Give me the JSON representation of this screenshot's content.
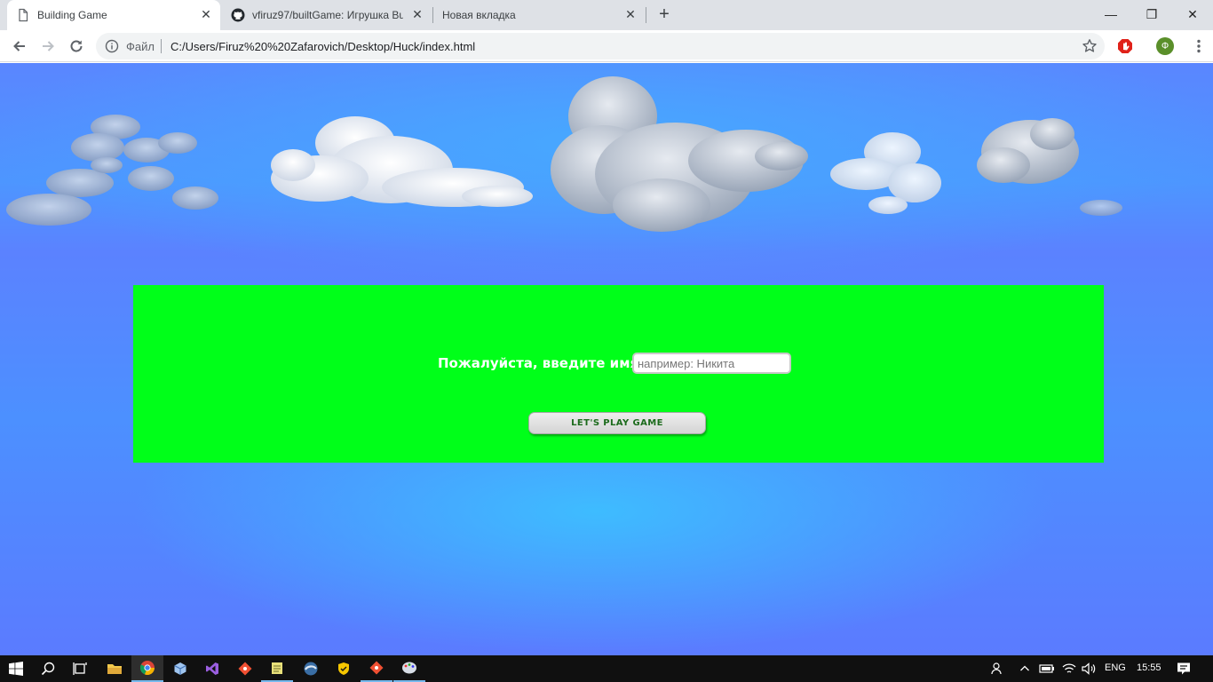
{
  "browser": {
    "tabs": [
      {
        "title": "Building Game",
        "icon": "page-icon",
        "active": true
      },
      {
        "title": "vfiruz97/builtGame: Игрушка Bui",
        "icon": "github-icon",
        "active": false
      },
      {
        "title": "Новая вкладка",
        "icon": "none",
        "active": false
      }
    ],
    "close_glyph": "✕",
    "new_tab_glyph": "+",
    "window_controls": {
      "minimize": "—",
      "restore": "❐",
      "close": "✕"
    },
    "address": {
      "scheme_label": "Файл",
      "url": "C:/Users/Firuz%20%20Zafarovich/Desktop/Huck/index.html"
    },
    "profile_initial": "Ф"
  },
  "page": {
    "prompt_label": "Пожалуйста, введите имя:",
    "name_input": {
      "value": "",
      "placeholder": "например: Никита"
    },
    "play_button": "LET'S PLAY GAME",
    "colors": {
      "panel": "#00ff19",
      "sky": "#4d96ff",
      "button_text": "#1c6b1c"
    }
  },
  "taskbar": {
    "apps": [
      "file-explorer-icon",
      "chrome-icon",
      "virtualbox-icon",
      "visual-studio-icon",
      "git-icon",
      "notepad-icon",
      "edge-dev-icon",
      "norton-icon",
      "sourcetree-icon",
      "paint-icon"
    ],
    "language": "ENG",
    "time": "15:55"
  }
}
